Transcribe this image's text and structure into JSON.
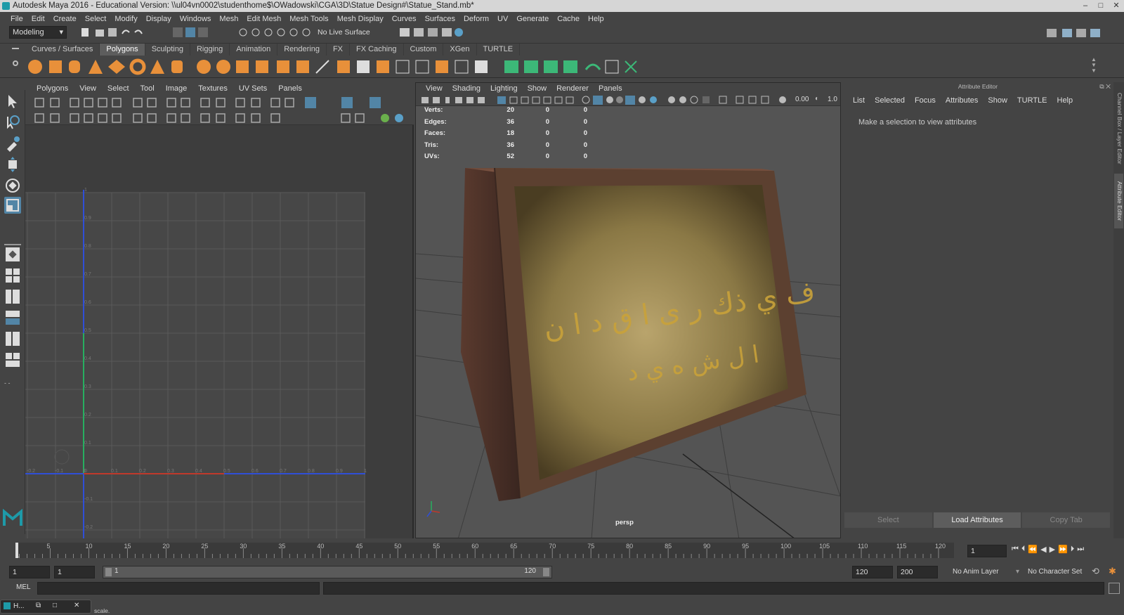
{
  "window": {
    "title": "Autodesk Maya 2016 - Educational Version: \\\\ul04vn0002\\studenthome$\\OWadowski\\CGA\\3D\\Statue Design#\\Statue_Stand.mb*",
    "minimize": "–",
    "maximize": "□",
    "close": "✕"
  },
  "menubar": [
    "File",
    "Edit",
    "Create",
    "Select",
    "Modify",
    "Display",
    "Windows",
    "Mesh",
    "Edit Mesh",
    "Mesh Tools",
    "Mesh Display",
    "Curves",
    "Surfaces",
    "Deform",
    "UV",
    "Generate",
    "Cache",
    "Help"
  ],
  "statusline": {
    "mode": "Modeling",
    "live_surface": "No Live Surface"
  },
  "shelf_tabs": [
    {
      "label": "Curves / Surfaces",
      "active": false
    },
    {
      "label": "Polygons",
      "active": true
    },
    {
      "label": "Sculpting",
      "active": false
    },
    {
      "label": "Rigging",
      "active": false
    },
    {
      "label": "Animation",
      "active": false
    },
    {
      "label": "Rendering",
      "active": false
    },
    {
      "label": "FX",
      "active": false
    },
    {
      "label": "FX Caching",
      "active": false
    },
    {
      "label": "Custom",
      "active": false
    },
    {
      "label": "XGen",
      "active": false
    },
    {
      "label": "TURTLE",
      "active": false
    }
  ],
  "uv_editor": {
    "menu": [
      "Polygons",
      "View",
      "Select",
      "Tool",
      "Image",
      "Textures",
      "UV Sets",
      "Panels"
    ],
    "v_ticks": [
      "1",
      "0.9",
      "0.8",
      "0.7",
      "0.6",
      "0.5",
      "0.4",
      "0.3",
      "0.2",
      "0.1",
      "0",
      "-0.1",
      "-0.2"
    ],
    "u_ticks": [
      "-0.2",
      "-0.1",
      "0",
      "0.1",
      "0.2",
      "0.3",
      "0.4",
      "0.5",
      "0.6",
      "0.7",
      "0.8",
      "0.9",
      "1"
    ]
  },
  "viewport": {
    "menu": [
      "View",
      "Shading",
      "Lighting",
      "Show",
      "Renderer",
      "Panels"
    ],
    "exposure": "0.00",
    "gamma": "1.0",
    "camera_label": "persp",
    "hud": [
      {
        "label": "Verts:",
        "a": "20",
        "b": "0",
        "c": "0"
      },
      {
        "label": "Edges:",
        "a": "36",
        "b": "0",
        "c": "0"
      },
      {
        "label": "Faces:",
        "a": "18",
        "b": "0",
        "c": "0"
      },
      {
        "label": "Tris:",
        "a": "36",
        "b": "0",
        "c": "0"
      },
      {
        "label": "UVs:",
        "a": "52",
        "b": "0",
        "c": "0"
      }
    ]
  },
  "attribute_editor": {
    "title": "Attribute Editor",
    "menu": [
      "List",
      "Selected",
      "Focus",
      "Attributes",
      "Show",
      "TURTLE",
      "Help"
    ],
    "message": "Make a selection to view attributes",
    "buttons": [
      {
        "label": "Select",
        "active": false
      },
      {
        "label": "Load Attributes",
        "active": true
      },
      {
        "label": "Copy Tab",
        "active": false
      }
    ],
    "side_tabs": [
      "Channel Box / Layer Editor",
      "Attribute Editor"
    ]
  },
  "timeline": {
    "ticks": [
      "5",
      "10",
      "15",
      "20",
      "25",
      "30",
      "35",
      "40",
      "45",
      "50",
      "55",
      "60",
      "65",
      "70",
      "75",
      "80",
      "85",
      "90",
      "95",
      "100",
      "105",
      "110",
      "115",
      "120"
    ],
    "current_frame": "1",
    "start_marker": "1"
  },
  "range": {
    "start": "1",
    "playback_start": "1",
    "slider_start": "1",
    "slider_end": "120",
    "playback_end": "120",
    "end": "200",
    "anim_layer": "No Anim Layer",
    "character_set": "No Character Set"
  },
  "command_line": {
    "label": "MEL"
  },
  "help_line": {
    "text": "scale.",
    "window_tab": "H..."
  },
  "colors": {
    "accent": "#5285a6",
    "teal_logo": "#1e9aa8",
    "u_axis": "#c0392b",
    "v_axis": "#27ae60",
    "grid_blue": "#2f4fd8"
  }
}
